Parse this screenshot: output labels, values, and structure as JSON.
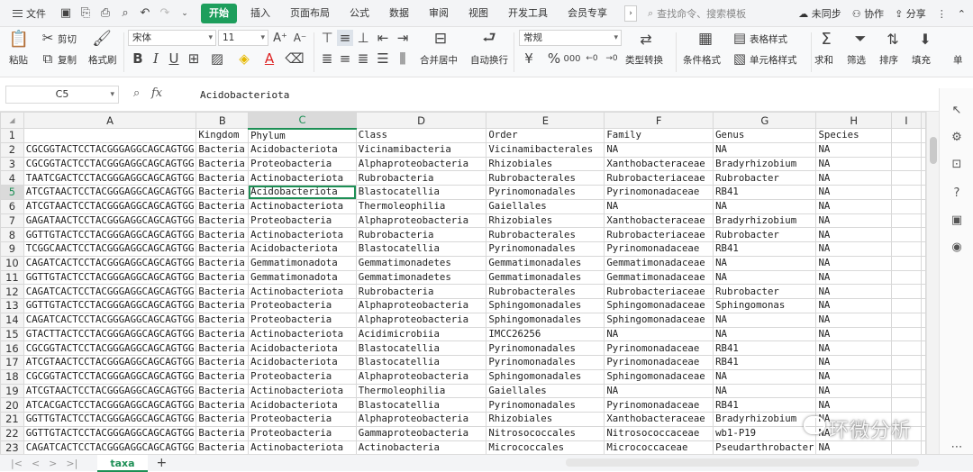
{
  "menubar": {
    "file": "文件",
    "items": [
      "开始",
      "插入",
      "页面布局",
      "公式",
      "数据",
      "审阅",
      "视图",
      "开发工具",
      "会员专享"
    ],
    "active_index": 0,
    "search_placeholder": "查找命令、搜索模板",
    "sync": "未同步",
    "collab": "协作",
    "share": "分享"
  },
  "toolbar": {
    "paste": "粘贴",
    "cut": "剪切",
    "copy": "复制",
    "format_painter": "格式刷",
    "font_name": "宋体",
    "font_size": "11",
    "merge": "合并居中",
    "wrap": "自动换行",
    "number_format": "常规",
    "type_convert": "类型转换",
    "cond_format": "条件格式",
    "table_style": "表格样式",
    "cell_style": "单元格样式",
    "sum": "求和",
    "filter": "筛选",
    "sort": "排序",
    "fill": "填充",
    "more": "单"
  },
  "formula_bar": {
    "cell_ref": "C5",
    "fx": "fx",
    "value": "Acidobacteriota"
  },
  "columns": [
    "A",
    "B",
    "C",
    "D",
    "E",
    "F",
    "G",
    "H",
    "I"
  ],
  "selected_column": "C",
  "selected_row": 5,
  "rows": [
    {
      "n": "1",
      "cells": [
        "",
        "Kingdom",
        "Phylum",
        "Class",
        "Order",
        "Family",
        "Genus",
        "Species",
        ""
      ]
    },
    {
      "n": "2",
      "cells": [
        "CGCGGTACTCCTACGGGAGGCAGCAGTGG",
        "Bacteria",
        "Acidobacteriota",
        "Vicinamibacteria",
        "Vicinamibacterales",
        "NA",
        "NA",
        "NA",
        ""
      ]
    },
    {
      "n": "3",
      "cells": [
        "CGCGGTACTCCTACGGGAGGCAGCAGTGG",
        "Bacteria",
        "Proteobacteria",
        "Alphaproteobacteria",
        "Rhizobiales",
        "Xanthobacteraceae",
        "Bradyrhizobium",
        "NA",
        ""
      ]
    },
    {
      "n": "4",
      "cells": [
        "TAATCGACTCCTACGGGAGGCAGCAGTGG",
        "Bacteria",
        "Actinobacteriota",
        "Rubrobacteria",
        "Rubrobacterales",
        "Rubrobacteriaceae",
        "Rubrobacter",
        "NA",
        ""
      ]
    },
    {
      "n": "5",
      "cells": [
        "ATCGTAACTCCTACGGGAGGCAGCAGTGG",
        "Bacteria",
        "Acidobacteriota",
        "Blastocatellia",
        "Pyrinomonadales",
        "Pyrinomonadaceae",
        "RB41",
        "NA",
        ""
      ]
    },
    {
      "n": "6",
      "cells": [
        "ATCGTAACTCCTACGGGAGGCAGCAGTGG",
        "Bacteria",
        "Actinobacteriota",
        "Thermoleophilia",
        "Gaiellales",
        "NA",
        "NA",
        "NA",
        ""
      ]
    },
    {
      "n": "7",
      "cells": [
        "GAGATAACTCCTACGGGAGGCAGCAGTGG",
        "Bacteria",
        "Proteobacteria",
        "Alphaproteobacteria",
        "Rhizobiales",
        "Xanthobacteraceae",
        "Bradyrhizobium",
        "NA",
        ""
      ]
    },
    {
      "n": "8",
      "cells": [
        "GGTTGTACTCCTACGGGAGGCAGCAGTGG",
        "Bacteria",
        "Actinobacteriota",
        "Rubrobacteria",
        "Rubrobacterales",
        "Rubrobacteriaceae",
        "Rubrobacter",
        "NA",
        ""
      ]
    },
    {
      "n": "9",
      "cells": [
        "TCGGCAACTCCTACGGGAGGCAGCAGTGG",
        "Bacteria",
        "Acidobacteriota",
        "Blastocatellia",
        "Pyrinomonadales",
        "Pyrinomonadaceae",
        "RB41",
        "NA",
        ""
      ]
    },
    {
      "n": "10",
      "cells": [
        "CAGATCACTCCTACGGGAGGCAGCAGTGG",
        "Bacteria",
        "Gemmatimonadota",
        "Gemmatimonadetes",
        "Gemmatimonadales",
        "Gemmatimonadaceae",
        "NA",
        "NA",
        ""
      ]
    },
    {
      "n": "11",
      "cells": [
        "GGTTGTACTCCTACGGGAGGCAGCAGTGG",
        "Bacteria",
        "Gemmatimonadota",
        "Gemmatimonadetes",
        "Gemmatimonadales",
        "Gemmatimonadaceae",
        "NA",
        "NA",
        ""
      ]
    },
    {
      "n": "12",
      "cells": [
        "CAGATCACTCCTACGGGAGGCAGCAGTGG",
        "Bacteria",
        "Actinobacteriota",
        "Rubrobacteria",
        "Rubrobacterales",
        "Rubrobacteriaceae",
        "Rubrobacter",
        "NA",
        ""
      ]
    },
    {
      "n": "13",
      "cells": [
        "GGTTGTACTCCTACGGGAGGCAGCAGTGG",
        "Bacteria",
        "Proteobacteria",
        "Alphaproteobacteria",
        "Sphingomonadales",
        "Sphingomonadaceae",
        "Sphingomonas",
        "NA",
        ""
      ]
    },
    {
      "n": "14",
      "cells": [
        "CAGATCACTCCTACGGGAGGCAGCAGTGG",
        "Bacteria",
        "Proteobacteria",
        "Alphaproteobacteria",
        "Sphingomonadales",
        "Sphingomonadaceae",
        "NA",
        "NA",
        ""
      ]
    },
    {
      "n": "15",
      "cells": [
        "GTACTTACTCCTACGGGAGGCAGCAGTGG",
        "Bacteria",
        "Actinobacteriota",
        "Acidimicrobiia",
        "IMCC26256",
        "NA",
        "NA",
        "NA",
        ""
      ]
    },
    {
      "n": "16",
      "cells": [
        "CGCGGTACTCCTACGGGAGGCAGCAGTGG",
        "Bacteria",
        "Acidobacteriota",
        "Blastocatellia",
        "Pyrinomonadales",
        "Pyrinomonadaceae",
        "RB41",
        "NA",
        ""
      ]
    },
    {
      "n": "17",
      "cells": [
        "ATCGTAACTCCTACGGGAGGCAGCAGTGG",
        "Bacteria",
        "Acidobacteriota",
        "Blastocatellia",
        "Pyrinomonadales",
        "Pyrinomonadaceae",
        "RB41",
        "NA",
        ""
      ]
    },
    {
      "n": "18",
      "cells": [
        "CGCGGTACTCCTACGGGAGGCAGCAGTGG",
        "Bacteria",
        "Proteobacteria",
        "Alphaproteobacteria",
        "Sphingomonadales",
        "Sphingomonadaceae",
        "NA",
        "NA",
        ""
      ]
    },
    {
      "n": "19",
      "cells": [
        "ATCGTAACTCCTACGGGAGGCAGCAGTGG",
        "Bacteria",
        "Actinobacteriota",
        "Thermoleophilia",
        "Gaiellales",
        "NA",
        "NA",
        "NA",
        ""
      ]
    },
    {
      "n": "20",
      "cells": [
        "ATCACGACTCCTACGGGAGGCAGCAGTGG",
        "Bacteria",
        "Acidobacteriota",
        "Blastocatellia",
        "Pyrinomonadales",
        "Pyrinomonadaceae",
        "RB41",
        "NA",
        ""
      ]
    },
    {
      "n": "21",
      "cells": [
        "GGTTGTACTCCTACGGGAGGCAGCAGTGG",
        "Bacteria",
        "Proteobacteria",
        "Alphaproteobacteria",
        "Rhizobiales",
        "Xanthobacteraceae",
        "Bradyrhizobium",
        "NA",
        ""
      ]
    },
    {
      "n": "22",
      "cells": [
        "GGTTGTACTCCTACGGGAGGCAGCAGTGG",
        "Bacteria",
        "Proteobacteria",
        "Gammaproteobacteria",
        "Nitrosococcales",
        "Nitrosococcaceae",
        "wb1-P19",
        "NA",
        ""
      ]
    },
    {
      "n": "23",
      "cells": [
        "CAGATCACTCCTACGGGAGGCAGCAGTGG",
        "Bacteria",
        "Actinobacteriota",
        "Actinobacteria",
        "Micrococcales",
        "Micrococcaceae",
        "Pseudarthrobacter",
        "NA",
        ""
      ]
    }
  ],
  "sheet_tab": "taxa",
  "watermark": "环微分析",
  "accent_color": "#1d9e5c"
}
